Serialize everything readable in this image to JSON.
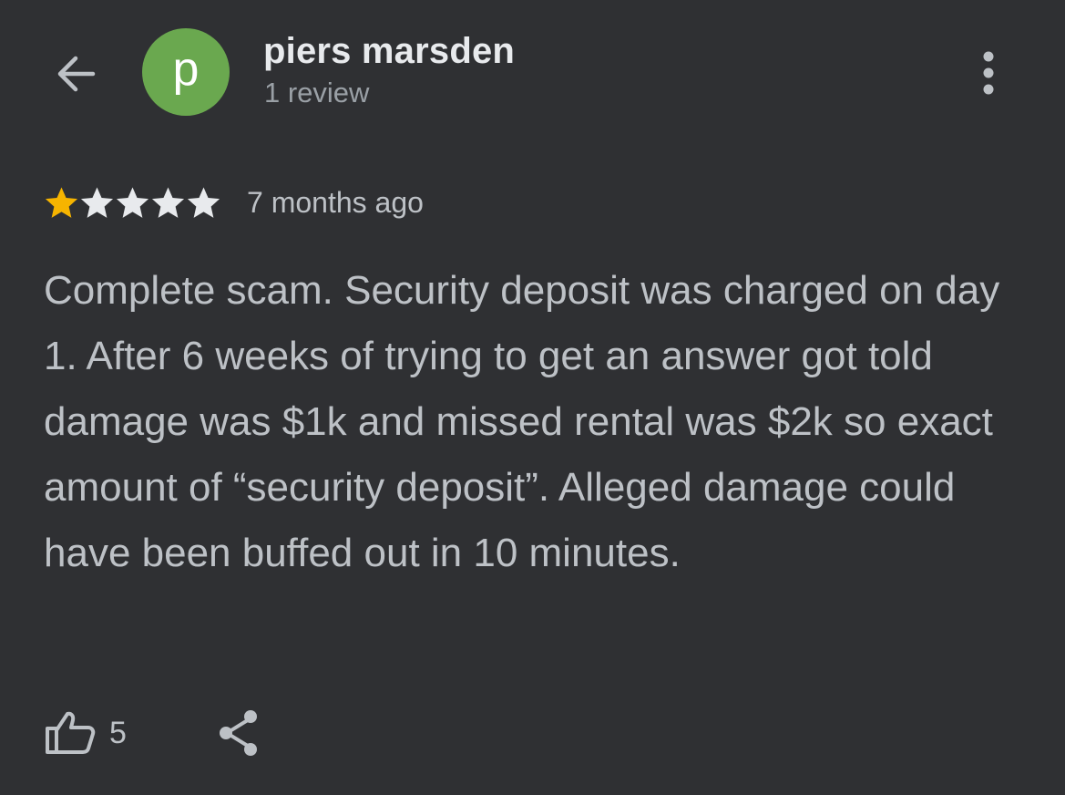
{
  "header": {
    "back_icon": "arrow-left-icon",
    "avatar_letter": "p",
    "avatar_color": "#6aa84f",
    "user_name": "piers marsden",
    "review_count": "1 review",
    "more_icon": "more-vertical-icon"
  },
  "review": {
    "rating": 1,
    "max_rating": 5,
    "star_filled_color": "#f6b400",
    "star_empty_color": "#e8eaed",
    "time_ago": "7 months ago",
    "text": "Complete scam. Security deposit was charged on day 1. After 6 weeks of trying to get an answer got told damage was $1k and missed rental was $2k so exact amount of “security deposit”. Alleged damage could have been buffed out in 10 minutes."
  },
  "actions": {
    "like_icon": "thumbs-up-icon",
    "like_count": "5",
    "share_icon": "share-icon"
  },
  "colors": {
    "background": "#2f3033",
    "text_primary": "#e8eaed",
    "text_secondary": "#bdc1c6",
    "text_muted": "#9aa0a6"
  }
}
